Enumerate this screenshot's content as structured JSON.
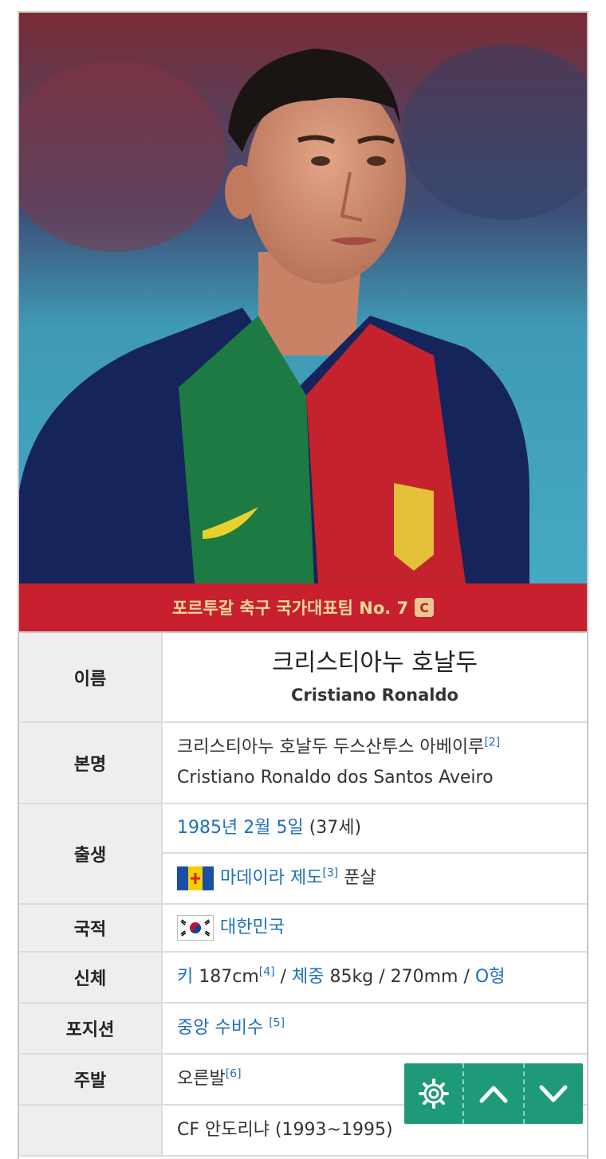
{
  "banner": {
    "team_label": "포르투갈 축구 국가대표팀 No. 7",
    "captain_badge": "C"
  },
  "rows": {
    "name": {
      "header": "이름",
      "korean": "크리스티아누 호날두",
      "english": "Cristiano Ronaldo"
    },
    "fullname": {
      "header": "본명",
      "korean": "크리스티아누 호날두 두스산투스 아베이루",
      "ref": "[2]",
      "english": "Cristiano Ronaldo dos Santos Aveiro"
    },
    "birth": {
      "header": "출생",
      "date": "1985년 2월 5일",
      "age": "(37세)",
      "place": "마데이라 제도",
      "place_ref": "[3]",
      "city": "푼샬"
    },
    "nationality": {
      "header": "국적",
      "country": "대한민국"
    },
    "body": {
      "header": "신체",
      "height_label": "키",
      "height": "187cm",
      "height_ref": "[4]",
      "sep1": " / ",
      "weight_label": "체중",
      "weight": "85kg",
      "rest": " / 270mm / ",
      "blood": "O형"
    },
    "position": {
      "header": "포지션",
      "value": "중앙 수비수",
      "ref": "[5]"
    },
    "foot": {
      "header": "주발",
      "value": "오른발",
      "ref": "[6]"
    },
    "youth": {
      "header": "",
      "value": "CF 안도리냐 (1993~1995)"
    }
  },
  "icons": {
    "settings": "gear-icon",
    "up": "chevron-up-icon",
    "down": "chevron-down-icon"
  },
  "colors": {
    "banner_bg": "#c8202f",
    "banner_text": "#f5d79a",
    "link": "#1f6fbf",
    "float_bar": "#1f9a78"
  }
}
